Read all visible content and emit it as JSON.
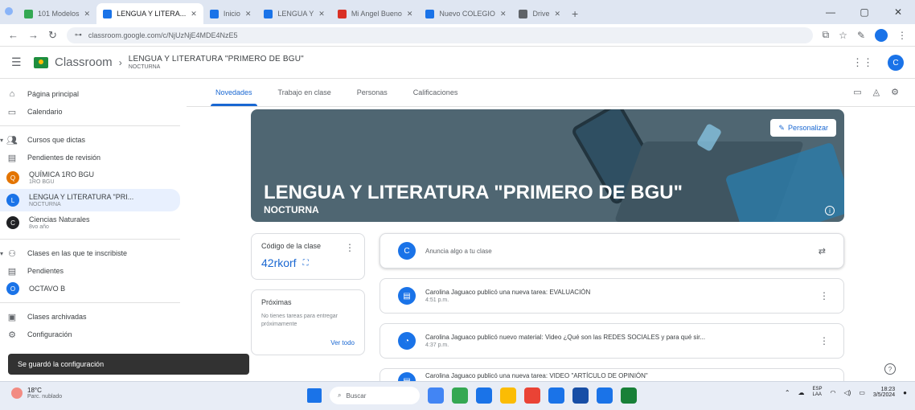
{
  "browser": {
    "tabs": [
      {
        "title": "101 Modelos",
        "color": "#34a853",
        "active": false
      },
      {
        "title": "LENGUA Y LITERA...",
        "color": "#1a73e8",
        "active": true
      },
      {
        "title": "Inicio",
        "color": "#1a73e8",
        "active": false
      },
      {
        "title": "LENGUA Y",
        "color": "#1a73e8",
        "active": false
      },
      {
        "title": "Mi Angel Bueno",
        "color": "#d93025",
        "active": false
      },
      {
        "title": "Nuevo COLEGIO",
        "color": "#1a73e8",
        "active": false
      },
      {
        "title": "Drive",
        "color": "#5f6368",
        "active": false
      }
    ],
    "url": "classroom.google.com/c/NjUzNjE4MDE4NzE5",
    "window_controls": [
      "—",
      "▢",
      "✕"
    ]
  },
  "header": {
    "brand": "Classroom",
    "course_title": "LENGUA Y LITERATURA \"PRIMERO DE BGU\"",
    "course_section": "NOCTURNA",
    "avatar_initial": "C"
  },
  "sidebar": {
    "items": [
      {
        "label": "Página principal",
        "icon": "⌂"
      },
      {
        "label": "Calendario",
        "icon": "▭"
      }
    ],
    "teaching_header": "Cursos que dictas",
    "teaching_items": [
      {
        "label": "Pendientes de revisión",
        "icon": "▤"
      },
      {
        "label": "QUÍMICA 1RO BGU",
        "sub": "1RO BGU",
        "initial": "Q",
        "color": "#e37400"
      },
      {
        "label": "LENGUA Y LITERATURA \"PRI...",
        "sub": "NOCTURNA",
        "initial": "L",
        "color": "#1a73e8"
      },
      {
        "label": "Ciencias Naturales",
        "sub": "8vo año",
        "initial": "C",
        "color": "#202124"
      }
    ],
    "enrolled_header": "Clases en las que te inscribiste",
    "enrolled_items": [
      {
        "label": "Pendientes",
        "icon": "▤"
      },
      {
        "label": "OCTAVO B",
        "initial": "O",
        "color": "#1a73e8"
      }
    ],
    "bottom_items": [
      {
        "label": "Clases archivadas",
        "icon": "▣"
      },
      {
        "label": "Configuración",
        "icon": "⚙"
      }
    ]
  },
  "course_tabs": [
    "Novedades",
    "Trabajo en clase",
    "Personas",
    "Calificaciones"
  ],
  "banner": {
    "title": "LENGUA Y LITERATURA \"PRIMERO DE BGU\"",
    "subtitle": "NOCTURNA",
    "customize_label": "Personalizar"
  },
  "class_code": {
    "label": "Código de la clase",
    "value": "42rkorf"
  },
  "upcoming": {
    "title": "Próximas",
    "body": "No tienes tareas para entregar próximamente",
    "link": "Ver todo"
  },
  "stream": {
    "announce_placeholder": "Anuncia algo a tu clase",
    "posts": [
      {
        "title": "Carolina Jaguaco publicó una nueva tarea: EVALUACIÓN",
        "time": "4:51 p.m.",
        "icon": "▤"
      },
      {
        "title": "Carolina Jaguaco publicó nuevo material: Video ¿Qué son las REDES SOCIALES y para qué sir...",
        "time": "4:37 p.m.",
        "icon": "◔"
      },
      {
        "title": "Carolina Jaguaco publicó una nueva tarea: VIDEO \"ARTÍCULO DE OPINIÓN\"",
        "time": "",
        "icon": "▤"
      }
    ]
  },
  "snackbar": "Se guardó la configuración",
  "taskbar": {
    "weather_temp": "18°C",
    "weather_desc": "Parc. nublado",
    "search_placeholder": "Buscar",
    "apps": [
      "#4285f4",
      "#34a853",
      "#1a73e8",
      "#fbbc04",
      "#ea4335",
      "#1a73e8",
      "#174ea6",
      "#1a73e8",
      "#188038"
    ],
    "lang": "ESP\nLAA",
    "time": "18:23",
    "date": "3/5/2024"
  }
}
